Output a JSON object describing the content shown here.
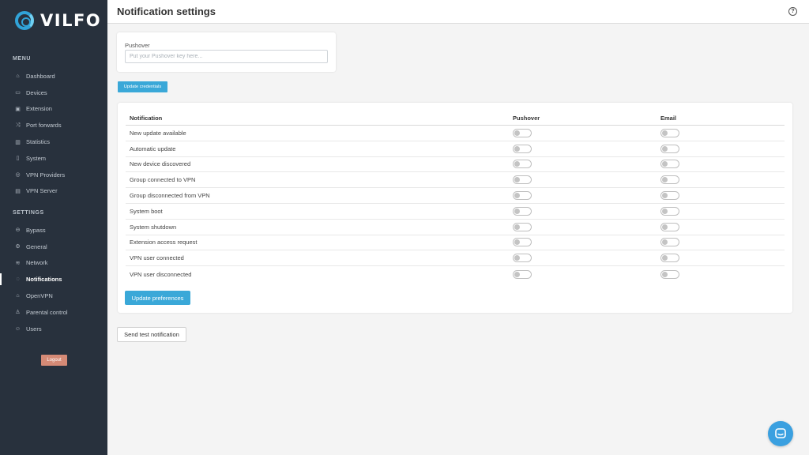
{
  "brand": {
    "name": "VILFO"
  },
  "sidebar": {
    "menu_title": "MENU",
    "menu_items": [
      {
        "label": "Dashboard",
        "icon": "⌂"
      },
      {
        "label": "Devices",
        "icon": "▭"
      },
      {
        "label": "Extension",
        "icon": "▣"
      },
      {
        "label": "Port forwards",
        "icon": "⤨"
      },
      {
        "label": "Statistics",
        "icon": "▥"
      },
      {
        "label": "System",
        "icon": "▯"
      },
      {
        "label": "VPN Providers",
        "icon": "◎"
      },
      {
        "label": "VPN Server",
        "icon": "▤"
      }
    ],
    "settings_title": "SETTINGS",
    "settings_items": [
      {
        "label": "Bypass",
        "icon": "⊖"
      },
      {
        "label": "General",
        "icon": "⚙"
      },
      {
        "label": "Network",
        "icon": "≋"
      },
      {
        "label": "Notifications",
        "icon": "◌"
      },
      {
        "label": "OpenVPN",
        "icon": "⌂"
      },
      {
        "label": "Parental control",
        "icon": "♙"
      },
      {
        "label": "Users",
        "icon": "☺"
      }
    ],
    "logout_label": "Logout"
  },
  "header": {
    "title": "Notification settings",
    "help_icon": "?"
  },
  "pushover": {
    "label": "Pushover",
    "placeholder": "Put your Pushover key here...",
    "value": "",
    "update_button": "Update credentials"
  },
  "preferences": {
    "columns": [
      "Notification",
      "Pushover",
      "Email"
    ],
    "rows": [
      {
        "label": "New update available",
        "pushover": false,
        "email": false
      },
      {
        "label": "Automatic update",
        "pushover": false,
        "email": false
      },
      {
        "label": "New device discovered",
        "pushover": false,
        "email": false
      },
      {
        "label": "Group connected to VPN",
        "pushover": false,
        "email": false
      },
      {
        "label": "Group disconnected from VPN",
        "pushover": false,
        "email": false
      },
      {
        "label": "System boot",
        "pushover": false,
        "email": false
      },
      {
        "label": "System shutdown",
        "pushover": false,
        "email": false
      },
      {
        "label": "Extension access request",
        "pushover": false,
        "email": false
      },
      {
        "label": "VPN user connected",
        "pushover": false,
        "email": false
      },
      {
        "label": "VPN user disconnected",
        "pushover": false,
        "email": false
      }
    ],
    "update_button": "Update preferences"
  },
  "test_button": "Send test notification",
  "colors": {
    "sidebar": "#28313d",
    "accent": "#3aa8d8",
    "logout": "#d58a76"
  }
}
